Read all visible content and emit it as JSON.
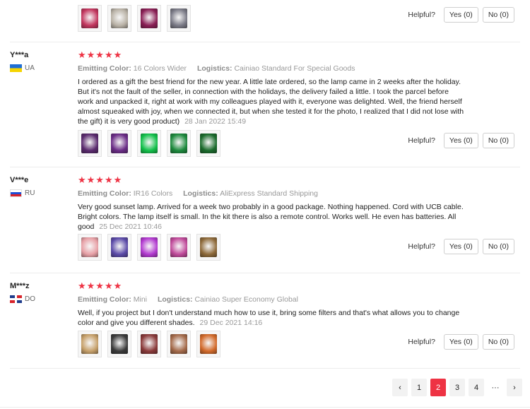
{
  "helpful_label": "Helpful?",
  "reviews": [
    {
      "user": "",
      "country": "",
      "stars": "",
      "color_key": "",
      "color_value": "",
      "logistics_key": "",
      "logistics_value": "",
      "text": "",
      "date": "",
      "thumbs": [
        {
          "icon": "sunset-lamp-photo",
          "color": "#c2365e"
        },
        {
          "icon": "lamp-box-photo",
          "color": "#b9b2a6"
        },
        {
          "icon": "lamp-glow-photo",
          "color": "#8a1f55"
        },
        {
          "icon": "remote-control-photo",
          "color": "#7a7a86"
        }
      ],
      "yes": "Yes (0)",
      "no": "No (0)"
    },
    {
      "user": "Y***a",
      "country": "UA",
      "stars": "★★★★★",
      "color_key": "Emitting Color:",
      "color_value": "16 Colors Wider",
      "logistics_key": "Logistics:",
      "logistics_value": "Cainiao Standard For Special Goods",
      "text": "I ordered as a gift the best friend for the new year. A little late ordered, so the lamp came in 2 weeks after the holiday. But it's not the fault of the seller, in connection with the holidays, the delivery failed a little. I took the parcel before work and unpacked it, right at work with my colleagues played with it, everyone was delighted. Well, the friend herself almost squeaked with joy, when we connected it, but when she tested it for the photo, I realized that I did not lose with the gift) it is very good product)",
      "date": "28 Jan 2022 15:49",
      "thumbs": [
        {
          "icon": "green-lamp-photo",
          "color": "#5a2a6e"
        },
        {
          "icon": "purple-wall-photo",
          "color": "#6a2c86"
        },
        {
          "icon": "green-glow-photo",
          "color": "#12c04a"
        },
        {
          "icon": "phone-lamp-photo",
          "color": "#1d8a3d"
        },
        {
          "icon": "green-circle-photo",
          "color": "#1a6b2c"
        }
      ],
      "yes": "Yes (0)",
      "no": "No (0)"
    },
    {
      "user": "V***e",
      "country": "RU",
      "stars": "★★★★★",
      "color_key": "Emitting Color:",
      "color_value": "IR16 Colors",
      "logistics_key": "Logistics:",
      "logistics_value": "AliExpress Standard Shipping",
      "text": "Very good sunset lamp. Arrived for a week two probably in a good package. Nothing happened. Cord with UCB cable. Bright colors. The lamp itself is small. In the kit there is also a remote control. Works well. He even has batteries. All good",
      "date": "25 Dec 2021 10:46",
      "thumbs": [
        {
          "icon": "pastel-circle-photo",
          "color": "#e7a0a6"
        },
        {
          "icon": "light-beams-photo",
          "color": "#5b4aa8"
        },
        {
          "icon": "magenta-glow-photo",
          "color": "#b23ad0"
        },
        {
          "icon": "pink-lamp-photo",
          "color": "#c04a9a"
        },
        {
          "icon": "purple-box-photo",
          "color": "#8e6a3a"
        }
      ],
      "yes": "Yes (0)",
      "no": "No (0)"
    },
    {
      "user": "M***z",
      "country": "DO",
      "stars": "★★★★★",
      "color_key": "Emitting Color:",
      "color_value": "Mini",
      "logistics_key": "Logistics:",
      "logistics_value": "Cainiao Super Economy Global",
      "text": "Well, if you project but I don't understand much how to use it, bring some filters and that's what allows you to change color and give you different shades.",
      "date": "29 Dec 2021 14:16",
      "thumbs": [
        {
          "icon": "rainbow-lamp-photo",
          "color": "#c6a06a"
        },
        {
          "icon": "dark-lamp-photo",
          "color": "#3a3a3a"
        },
        {
          "icon": "red-dot-photo",
          "color": "#8a3a3a"
        },
        {
          "icon": "warm-room-photo",
          "color": "#a46a4a"
        },
        {
          "icon": "orange-glow-photo",
          "color": "#d26a2a"
        }
      ],
      "yes": "Yes (0)",
      "no": "No (0)"
    }
  ],
  "pagination": {
    "prev_icon": "chevron-left-icon",
    "next_icon": "chevron-right-icon",
    "prev": "‹",
    "next": "›",
    "pages": [
      "1",
      "2",
      "3",
      "4"
    ],
    "active": "2",
    "ellipsis": "···"
  }
}
